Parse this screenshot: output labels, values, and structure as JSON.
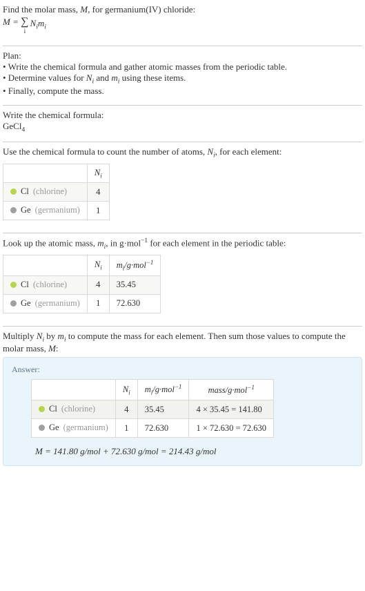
{
  "intro": {
    "line1_pre": "Find the molar mass, ",
    "line1_M": "M",
    "line1_post": ", for germanium(IV) chloride:",
    "formula_M": "M",
    "formula_eq": " = ",
    "sigma": "∑",
    "sigma_sub": "i",
    "formula_rhs_N": "N",
    "formula_rhs_m": "m"
  },
  "plan": {
    "heading": "Plan:",
    "b1": "• Write the chemical formula and gather atomic masses from the periodic table.",
    "b2_pre": "• Determine values for ",
    "b2_N": "N",
    "b2_and": " and ",
    "b2_m": "m",
    "b2_post": " using these items.",
    "b3": "• Finally, compute the mass."
  },
  "formula_sec": {
    "heading": "Write the chemical formula:",
    "formula_base": "GeCl",
    "formula_sub": "4"
  },
  "count_sec": {
    "text_pre": "Use the chemical formula to count the number of atoms, ",
    "N": "N",
    "text_post": ", for each element:",
    "header_N": "N",
    "cl_sym": "Cl",
    "cl_name": "(chlorine)",
    "cl_N": "4",
    "ge_sym": "Ge",
    "ge_name": "(germanium)",
    "ge_N": "1"
  },
  "mass_sec": {
    "text_pre": "Look up the atomic mass, ",
    "m": "m",
    "text_mid": ", in g·mol",
    "exp": "−1",
    "text_post": " for each element in the periodic table:",
    "header_N": "N",
    "header_m_pre": "m",
    "header_m_unit": "/g·mol",
    "cl_sym": "Cl",
    "cl_name": "(chlorine)",
    "cl_N": "4",
    "cl_m": "35.45",
    "ge_sym": "Ge",
    "ge_name": "(germanium)",
    "ge_N": "1",
    "ge_m": "72.630"
  },
  "compute_sec": {
    "text_pre": "Multiply ",
    "N": "N",
    "text_mid1": " by ",
    "m": "m",
    "text_mid2": " to compute the mass for each element. Then sum those values to compute the molar mass, ",
    "M": "M",
    "text_post": ":"
  },
  "answer": {
    "label": "Answer:",
    "header_N": "N",
    "header_m_pre": "m",
    "header_m_unit": "/g·mol",
    "header_mass_pre": "mass/g·mol",
    "exp": "−1",
    "cl_sym": "Cl",
    "cl_name": "(chlorine)",
    "cl_N": "4",
    "cl_m": "35.45",
    "cl_mass": "4 × 35.45 = 141.80",
    "ge_sym": "Ge",
    "ge_name": "(germanium)",
    "ge_N": "1",
    "ge_m": "72.630",
    "ge_mass": "1 × 72.630 = 72.630",
    "final_M": "M",
    "final_eq": " = 141.80 g/mol + 72.630 g/mol = 214.43 g/mol"
  }
}
